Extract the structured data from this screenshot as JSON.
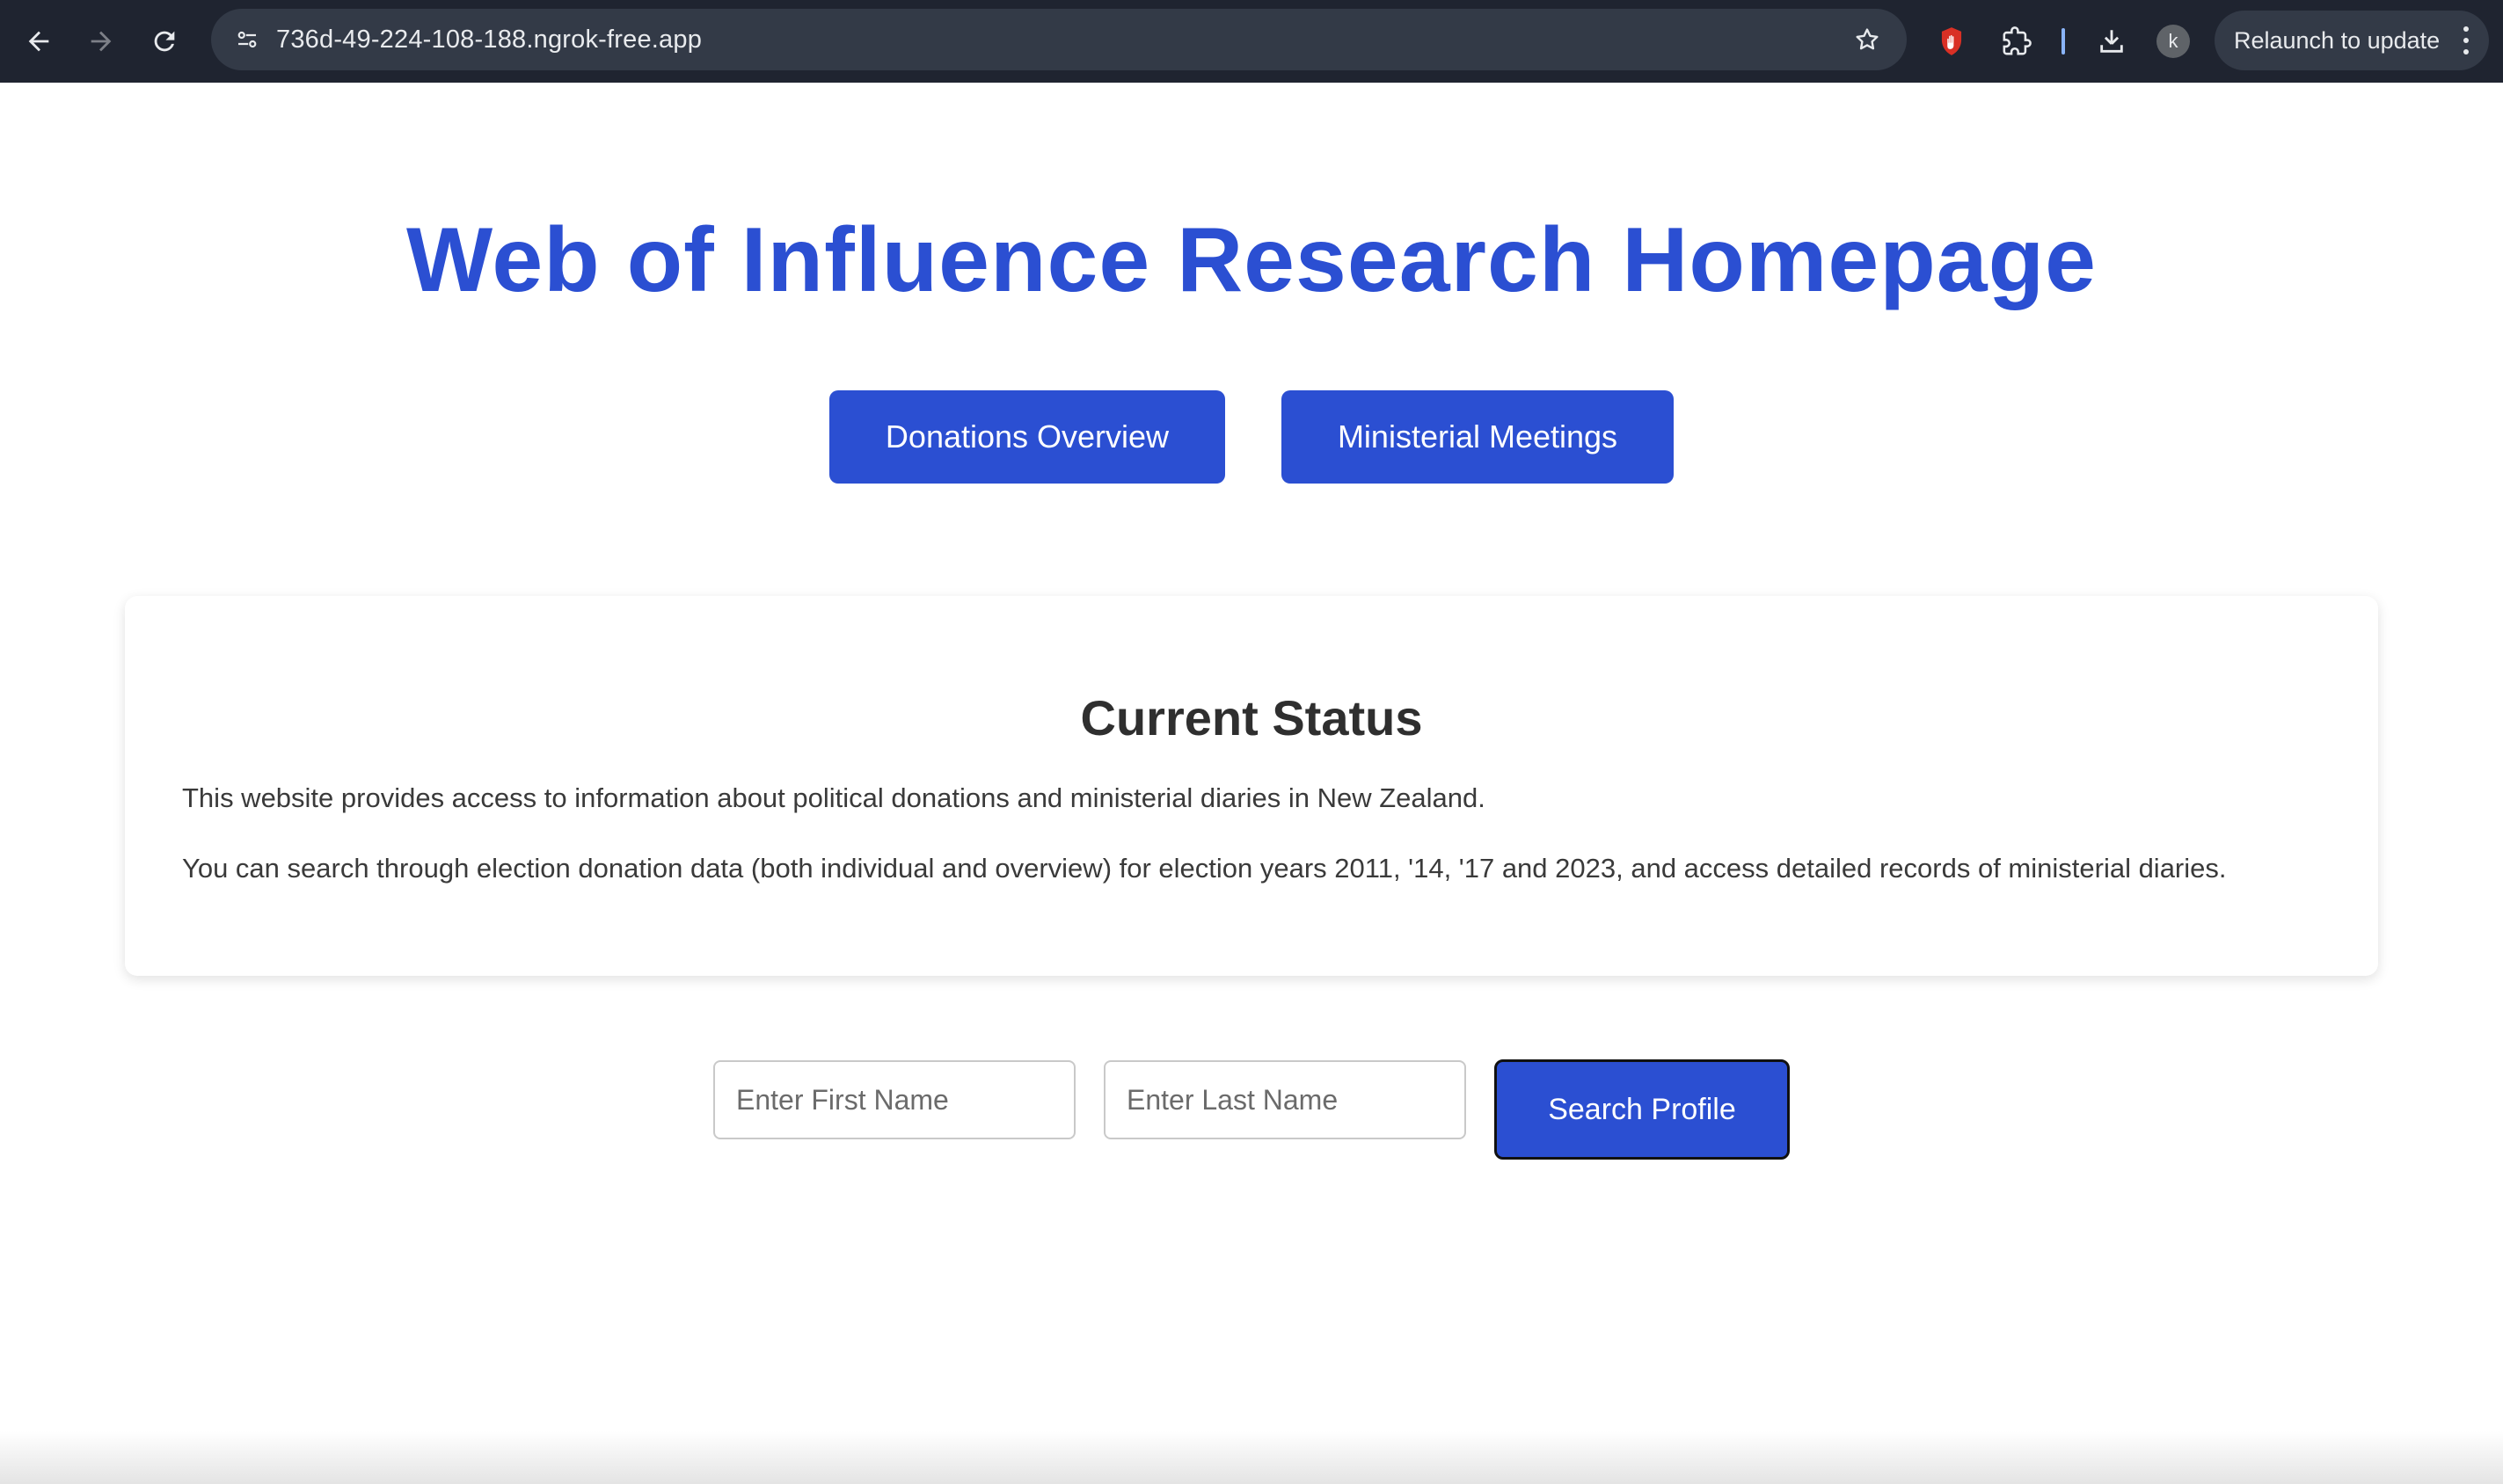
{
  "browser": {
    "url": "736d-49-224-108-188.ngrok-free.app",
    "avatar_initial": "k",
    "relaunch_label": "Relaunch to update",
    "icons": [
      "back-arrow-icon",
      "forward-arrow-icon",
      "reload-icon",
      "site-info-icon",
      "bookmark-star-icon",
      "extension-shield-icon",
      "extensions-puzzle-icon",
      "download-icon",
      "kebab-menu-icon"
    ]
  },
  "page": {
    "title": "Web of Influence Research Homepage",
    "nav_buttons": {
      "donations": "Donations Overview",
      "meetings": "Ministerial Meetings"
    },
    "status": {
      "heading": "Current Status",
      "paragraph_1": "This website provides access to information about political donations and ministerial diaries in New Zealand.",
      "paragraph_2": "You can search through election donation data (both individual and overview) for election years 2011, '14, '17 and 2023, and access detailed records of ministerial diaries."
    },
    "search": {
      "first_name_placeholder": "Enter First Name",
      "first_name_value": "",
      "last_name_placeholder": "Enter Last Name",
      "last_name_value": "",
      "button_label": "Search Profile"
    }
  },
  "colors": {
    "chrome_bg": "#1f2430",
    "omnibox_bg": "#333a47",
    "accent_blue": "#2b4fd2",
    "heading_text": "#2f2f2f",
    "body_text": "#3a3a3a"
  }
}
